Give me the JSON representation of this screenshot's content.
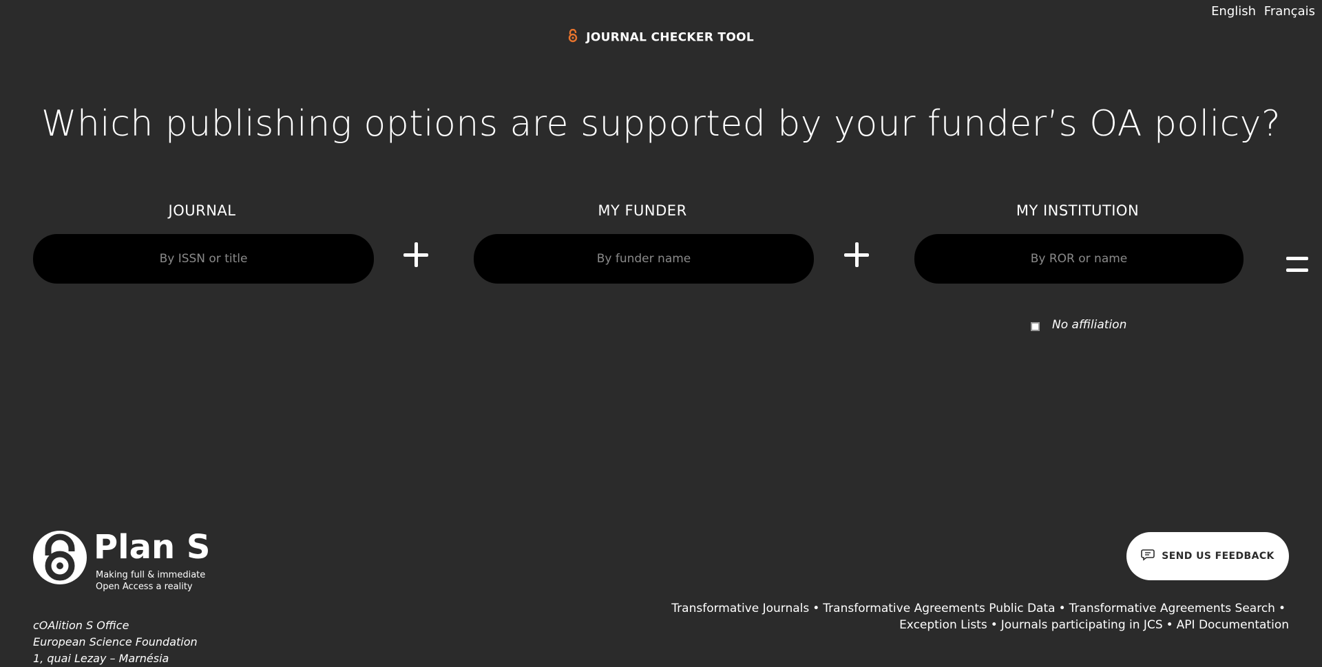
{
  "languages": [
    "English",
    "Français"
  ],
  "brand": {
    "title": "JOURNAL CHECKER TOOL",
    "accent": "#e8742d"
  },
  "headline": "Which publishing options are supported by your funder’s OA policy?",
  "columns": {
    "journal": {
      "label": "JOURNAL",
      "placeholder": "By ISSN or title"
    },
    "funder": {
      "label": "MY FUNDER",
      "placeholder": "By funder name"
    },
    "institution": {
      "label": "MY INSTITUTION",
      "placeholder": "By ROR or name"
    }
  },
  "no_affiliation": "No affiliation",
  "logo": {
    "title": "Plan S",
    "tag_line1": "Making full & immediate",
    "tag_line2": "Open Access a reality"
  },
  "address": [
    "cOAlition S Office",
    "European Science Foundation",
    "1, quai Lezay – Marnésia"
  ],
  "feedback_label": "SEND US FEEDBACK",
  "footer_links_row1": [
    "Transformative Journals",
    "Transformative Agreements Public Data",
    "Transformative Agreements Search"
  ],
  "footer_links_row2": [
    "Exception Lists",
    "Journals participating in JCS",
    "API Documentation"
  ],
  "icons": {
    "brand": "open-lock-icon",
    "feedback": "speech-bubble-icon",
    "logo": "open-access-lock-icon"
  }
}
